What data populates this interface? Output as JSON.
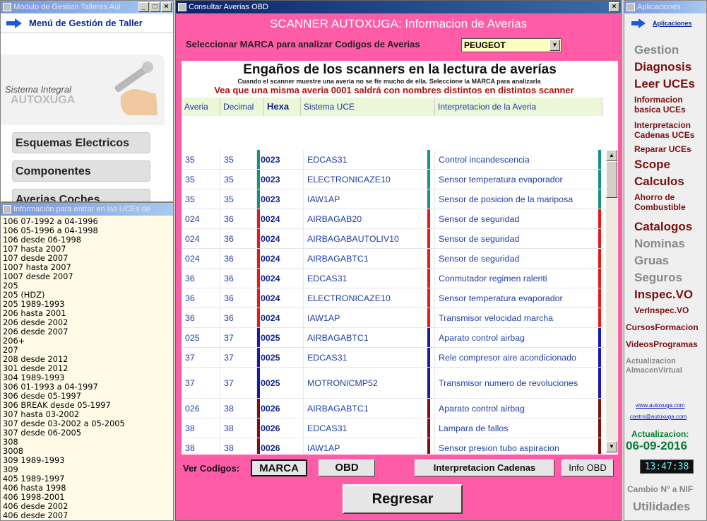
{
  "left_top": {
    "title": "Modulo de Gestion Talleres Aut",
    "menu_title": "Menú de Gestión de Taller",
    "logo_line1": "Sistema Integral",
    "logo_line2": "AUTOXUGA",
    "buttons": [
      "Esquemas Electricos",
      "Componentes",
      "Averias Coches"
    ]
  },
  "left_bottom": {
    "title": "Información para entrar en las UCEs de",
    "items": [
      "106 07-1992 a 04-1996",
      "106 05-1996 a 04-1998",
      "106 desde 06-1998",
      "107 hasta 2007",
      "107 desde 2007",
      "1007 hasta 2007",
      "1007 desde 2007",
      "205",
      "205 (HDZ)",
      "205 1989-1993",
      "206 hasta 2001",
      "206 desde 2002",
      "206 desde 2007",
      "206+",
      "207",
      "208 desde 2012",
      "301 desde 2012",
      "304 1989-1993",
      "306 01-1993 a 04-1997",
      "306 desde 05-1997",
      "306 BREAK desde 05-1997",
      "307 hasta 03-2002",
      "307 desde 03-2002 a 05-2005",
      "307 desde 06-2005",
      "308",
      "3008",
      "309 1989-1993",
      "309",
      "405 1989-1997",
      "406 hasta 1998",
      "406 1998-2001",
      "406 desde 2002",
      "406 desde 2007"
    ]
  },
  "center": {
    "title": "Consultar Averias OBD",
    "header": "SCANNER AUTOXUGA: Informacion de Averias",
    "brand_label": "Seleccionar MARCA para analizar Codigos de Averias",
    "brand_value": "PEUGEOT",
    "panel_title": "Engaños de los scanners en la lectura de averías",
    "panel_sub": "Cuando el scanner muestre una averia no se fie mucho de ella. Seleccione la MARCA para analizarla",
    "panel_warn": "Vea que una misma averia 0001 saldrá con nombres distintos en distintos scanner",
    "columns": [
      "Averia",
      "Decimal",
      "Hexa",
      "Sistema UCE",
      "Interpretacion de la Averia"
    ],
    "rows": [
      {
        "averia": "35",
        "decimal": "35",
        "hexa": "0023",
        "sistema": "EDCAS31",
        "interp": "Control incandescencia",
        "color": "#1a9080",
        "tall": false
      },
      {
        "averia": "35",
        "decimal": "35",
        "hexa": "0023",
        "sistema": "ELECTRONICAZE10",
        "interp": "Sensor temperatura evaporador",
        "color": "#1a9080",
        "tall": false
      },
      {
        "averia": "35",
        "decimal": "35",
        "hexa": "0023",
        "sistema": "IAW1AP",
        "interp": "Sensor de posicion de la mariposa",
        "color": "#1a9080",
        "tall": false
      },
      {
        "averia": "024",
        "decimal": "36",
        "hexa": "0024",
        "sistema": "AIRBAGAB20",
        "interp": "Sensor de seguridad",
        "color": "#e81818",
        "tall": false
      },
      {
        "averia": "024",
        "decimal": "36",
        "hexa": "0024",
        "sistema": "AIRBAGABAUTOLIV10",
        "interp": "Sensor de seguridad",
        "color": "#e81818",
        "tall": false
      },
      {
        "averia": "024",
        "decimal": "36",
        "hexa": "0024",
        "sistema": "AIRBAGABTC1",
        "interp": "Sensor de seguridad",
        "color": "#e81818",
        "tall": false
      },
      {
        "averia": "36",
        "decimal": "36",
        "hexa": "0024",
        "sistema": "EDCAS31",
        "interp": "Conmutador regimen ralenti",
        "color": "#e81818",
        "tall": false
      },
      {
        "averia": "36",
        "decimal": "36",
        "hexa": "0024",
        "sistema": "ELECTRONICAZE10",
        "interp": "Sensor temperatura evaporador",
        "color": "#e81818",
        "tall": false
      },
      {
        "averia": "36",
        "decimal": "36",
        "hexa": "0024",
        "sistema": "IAW1AP",
        "interp": "Transmisor velocidad marcha",
        "color": "#e81818",
        "tall": false
      },
      {
        "averia": "025",
        "decimal": "37",
        "hexa": "0025",
        "sistema": "AIRBAGABTC1",
        "interp": "Aparato control airbag",
        "color": "#1818b0",
        "tall": false
      },
      {
        "averia": "37",
        "decimal": "37",
        "hexa": "0025",
        "sistema": "EDCAS31",
        "interp": "Rele compresor aire acondicionado",
        "color": "#1818b0",
        "tall": false
      },
      {
        "averia": "37",
        "decimal": "37",
        "hexa": "0025",
        "sistema": "MOTRONICMP52",
        "interp": "Transmisor numero de revoluciones",
        "color": "#1818b0",
        "tall": true
      },
      {
        "averia": "026",
        "decimal": "38",
        "hexa": "0026",
        "sistema": "AIRBAGABTC1",
        "interp": "Aparato control airbag",
        "color": "#7a1010",
        "tall": false
      },
      {
        "averia": "38",
        "decimal": "38",
        "hexa": "0026",
        "sistema": "EDCAS31",
        "interp": "Lampara de fallos",
        "color": "#7a1010",
        "tall": false
      },
      {
        "averia": "38",
        "decimal": "38",
        "hexa": "0026",
        "sistema": "IAW1AP",
        "interp": "Sensor presion tubo aspiracion",
        "color": "#7a1010",
        "tall": false
      }
    ],
    "ver_codigos": "Ver Codigos:",
    "btn_marca": "MARCA",
    "btn_obd": "OBD",
    "btn_interp": "Interpretacion Cadenas",
    "btn_info": "Info OBD",
    "btn_regresar": "Regresar"
  },
  "right": {
    "title": "Aplicaciones",
    "head": "Aplicaciones",
    "items": [
      {
        "label": "Gestion",
        "style": "grey",
        "size": 17
      },
      {
        "label": "Diagnosis",
        "style": "red",
        "size": 17
      },
      {
        "label": "Leer UCEs",
        "style": "red",
        "size": 17
      },
      {
        "label": "Informacion\nbasica UCEs",
        "style": "red",
        "size": 12
      },
      {
        "label": "Interpretacion\nCadenas UCEs",
        "style": "red",
        "size": 12
      },
      {
        "label": "Reparar UCEs",
        "style": "red",
        "size": 12
      },
      {
        "label": "Scope",
        "style": "red",
        "size": 17
      },
      {
        "label": "Calculos",
        "style": "red",
        "size": 17
      },
      {
        "label": "Ahorro de\nCombustible",
        "style": "red",
        "size": 12
      },
      {
        "label": "Catalogos",
        "style": "red",
        "size": 17
      },
      {
        "label": "Nominas",
        "style": "grey",
        "size": 17
      },
      {
        "label": "Gruas",
        "style": "grey",
        "size": 17
      },
      {
        "label": "Seguros",
        "style": "grey",
        "size": 17
      },
      {
        "label": "Inspec.VO",
        "style": "red",
        "size": 17
      },
      {
        "label": "VerInspec.VO",
        "style": "red",
        "size": 12
      },
      {
        "label": "CursosFormacion",
        "style": "red",
        "size": 12
      },
      {
        "label": "VideosProgramas",
        "style": "red",
        "size": 12
      },
      {
        "label": "Actualizacion\nAlmacenVirtual",
        "style": "grey",
        "size": 11
      }
    ],
    "link1": "www.autoxuga.com",
    "link2": "castro@autoxuga.com",
    "update_label": "Actualizacion:",
    "update_date": "06-09-2016",
    "clock": "13:47:38",
    "cambio": "Cambio Nº a NIF",
    "utilidades": "Utilidades"
  }
}
